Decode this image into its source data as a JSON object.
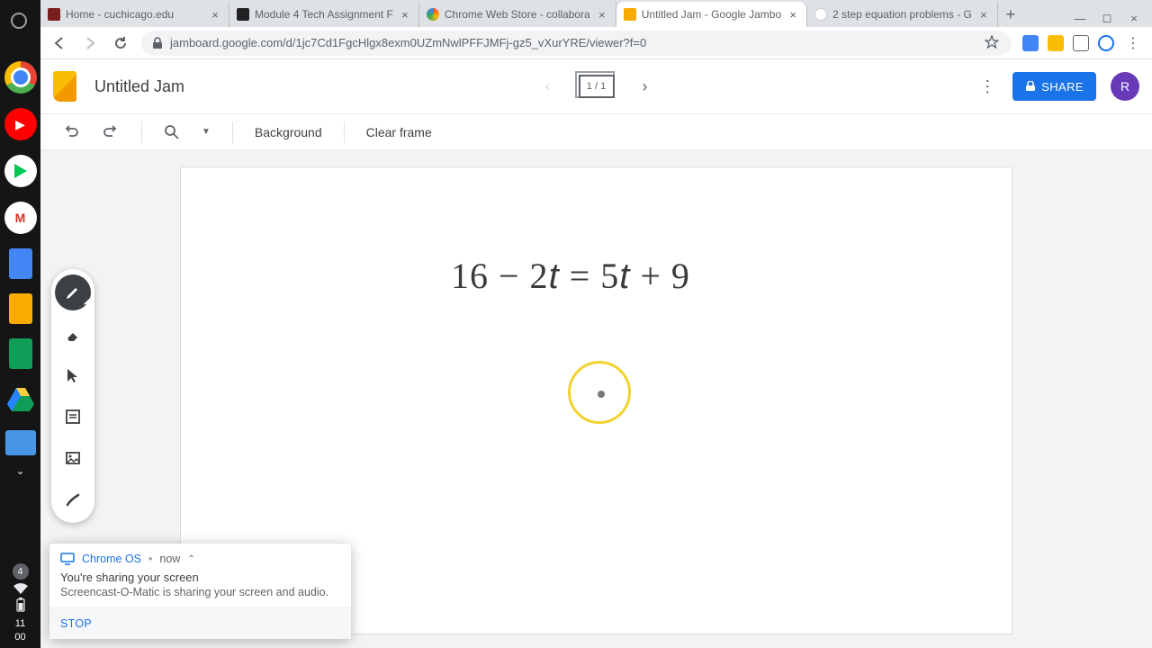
{
  "browser": {
    "tabs": [
      {
        "title": "Home - cuchicago.edu"
      },
      {
        "title": "Module 4 Tech Assignment F"
      },
      {
        "title": "Chrome Web Store - collabora"
      },
      {
        "title": "Untitled Jam - Google Jambo"
      },
      {
        "title": "2 step equation problems - G"
      }
    ],
    "active_tab_index": 3,
    "url": "jamboard.google.com/d/1jc7Cd1FgcHlgx8exm0UZmNwlPFFJMFj-gz5_vXurYRE/viewer?f=0"
  },
  "doc": {
    "title": "Untitled Jam",
    "frame_label": "1 / 1",
    "share": "SHARE",
    "avatar_letter": "R"
  },
  "toolbar2": {
    "background": "Background",
    "clear": "Clear frame"
  },
  "canvas": {
    "equation_plain": "16 − 2t = 5t + 9"
  },
  "toast": {
    "source": "Chrome OS",
    "time": "now",
    "title": "You're sharing your screen",
    "body": "Screencast-O-Matic is sharing your screen and audio.",
    "stop": "STOP"
  },
  "shelf": {
    "clock_top": "11",
    "clock_bottom": "00",
    "notification_count": "4"
  }
}
